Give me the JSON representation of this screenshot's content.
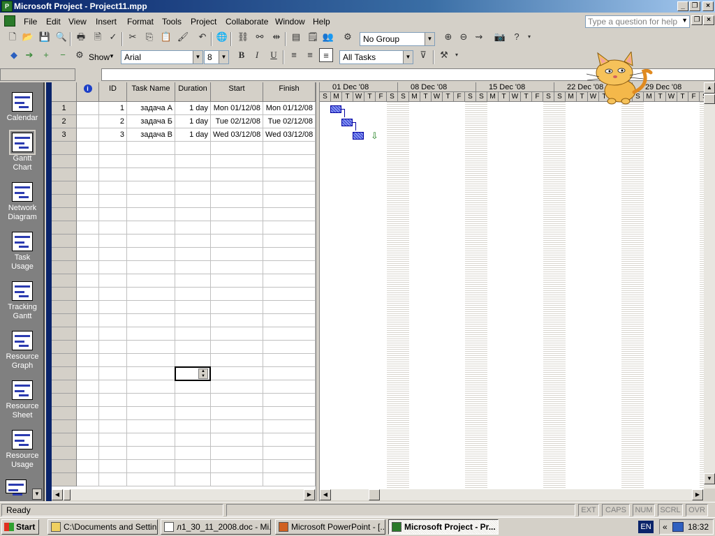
{
  "window": {
    "title": "Microsoft Project - Project11.mpp"
  },
  "menu": {
    "items": [
      "File",
      "Edit",
      "View",
      "Insert",
      "Format",
      "Tools",
      "Project",
      "Collaborate",
      "Window",
      "Help"
    ],
    "help_placeholder": "Type a question for help"
  },
  "toolbar": {
    "group_combo": "No Group",
    "show_label": "Show",
    "font_name": "Arial",
    "font_size": "8",
    "filter_combo": "All Tasks",
    "bold": "B",
    "italic": "I",
    "underline": "U"
  },
  "viewbar": {
    "items": [
      {
        "label": "Calendar",
        "icon": "calendar-icon"
      },
      {
        "label": "Gantt\nChart",
        "icon": "gantt-chart-icon",
        "active": true
      },
      {
        "label": "Network\nDiagram",
        "icon": "network-diagram-icon"
      },
      {
        "label": "Task\nUsage",
        "icon": "task-usage-icon"
      },
      {
        "label": "Tracking\nGantt",
        "icon": "tracking-gantt-icon"
      },
      {
        "label": "Resource\nGraph",
        "icon": "resource-graph-icon"
      },
      {
        "label": "Resource\nSheet",
        "icon": "resource-sheet-icon"
      },
      {
        "label": "Resource\nUsage",
        "icon": "resource-usage-icon"
      }
    ]
  },
  "sheet": {
    "columns": [
      "",
      "ID",
      "Task Name",
      "Duration",
      "Start",
      "Finish"
    ],
    "rows": [
      {
        "row": "1",
        "id": "1",
        "name": "задача А",
        "duration": "1 day",
        "start": "Mon 01/12/08",
        "finish": "Mon 01/12/08"
      },
      {
        "row": "2",
        "id": "2",
        "name": "задача Б",
        "duration": "1 day",
        "start": "Tue 02/12/08",
        "finish": "Tue 02/12/08"
      },
      {
        "row": "3",
        "id": "3",
        "name": "задача В",
        "duration": "1 day",
        "start": "Wed 03/12/08",
        "finish": "Wed 03/12/08"
      }
    ]
  },
  "gantt": {
    "weeks": [
      "01 Dec '08",
      "08 Dec '08",
      "15 Dec '08",
      "22 Dec '08",
      "29 Dec '08"
    ],
    "day_letters": [
      "S",
      "M",
      "T",
      "W",
      "T",
      "F",
      "S"
    ]
  },
  "status": {
    "ready": "Ready",
    "indicators": [
      "EXT",
      "CAPS",
      "NUM",
      "SCRL",
      "OVR"
    ]
  },
  "taskbar": {
    "start": "Start",
    "tasks": [
      {
        "label": "C:\\Documents and Settin...",
        "icon": "folder-icon"
      },
      {
        "label": "л1_30_11_2008.doc - Mi...",
        "icon": "word-icon"
      },
      {
        "label": "Microsoft PowerPoint - [...",
        "icon": "powerpoint-icon"
      },
      {
        "label": "Microsoft Project - Pr...",
        "icon": "project-icon",
        "active": true
      }
    ],
    "lang": "EN",
    "clock": "18:32"
  }
}
